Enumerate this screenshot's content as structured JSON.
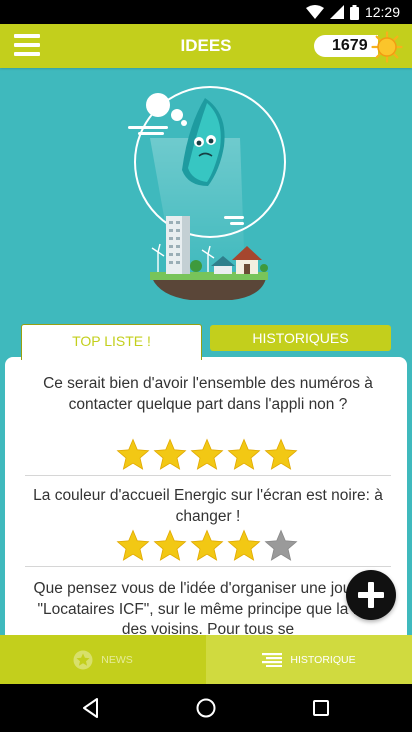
{
  "status_bar": {
    "time": "12:29"
  },
  "app_bar": {
    "title": "IDEES",
    "score": "1679"
  },
  "tabs": {
    "top": "TOP LISTE !",
    "history": "HISTORIQUES"
  },
  "ideas": [
    {
      "text": "Ce serait bien d'avoir l'ensemble des numéros à contacter quelque part dans l'appli non ?",
      "rating": 5
    },
    {
      "text": "La couleur d'accueil Energic sur l'écran est noire: à changer !",
      "rating": 4
    },
    {
      "text": "Que pensez vous de l'idée d'organiser une journée \"Locataires ICF\", sur le même principe que la fête des voisins. Pour tous se",
      "rating": null
    }
  ],
  "bottom_nav": {
    "news": "NEWS",
    "history": "HISTORIQUE"
  },
  "colors": {
    "accent": "#c3cf1c",
    "background": "#3fb9bd",
    "star_filled": "#f2c814",
    "star_empty": "#9a9a9a"
  },
  "icons": [
    "menu-icon",
    "sun-icon",
    "plus-icon",
    "star-icon",
    "list-icon",
    "back-icon",
    "home-icon",
    "recents-icon",
    "wifi-icon",
    "signal-icon",
    "battery-icon"
  ]
}
